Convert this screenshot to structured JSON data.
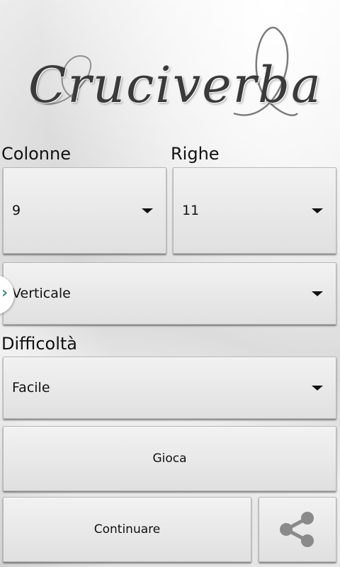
{
  "app": {
    "logo_text": "Cruciverba"
  },
  "labels": {
    "columns": "Colonne",
    "rows": "Righe",
    "difficulty": "Difficoltà"
  },
  "spinners": {
    "columns_value": "9",
    "rows_value": "11",
    "orientation_value": "Verticale",
    "difficulty_value": "Facile"
  },
  "buttons": {
    "play_label": "Gioca",
    "continue_label": "Continuare"
  },
  "icons": {
    "share": "share-icon",
    "drawer": "chevron-right-icon",
    "dropdown": "caret-down-icon"
  },
  "colors": {
    "drawer_chevron": "#3c8f86",
    "share_icon": "#8a8a8a"
  }
}
